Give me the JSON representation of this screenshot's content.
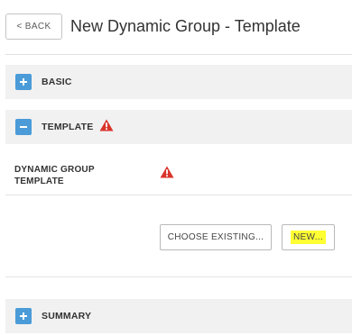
{
  "header": {
    "back_label": "< BACK",
    "title": "New Dynamic Group - Template"
  },
  "sections": {
    "basic": {
      "label": "BASIC",
      "state": "collapsed",
      "icon": "plus-icon"
    },
    "template": {
      "label": "TEMPLATE",
      "state": "expanded",
      "icon": "minus-icon",
      "warning_icon": "warning-icon"
    },
    "summary": {
      "label": "SUMMARY",
      "state": "collapsed",
      "icon": "plus-icon"
    }
  },
  "template_form": {
    "field_label": "DYNAMIC GROUP TEMPLATE",
    "warning_icon": "warning-icon",
    "choose_existing_label": "CHOOSE EXISTING...",
    "new_label": "NEW..."
  },
  "colors": {
    "toggle_blue": "#4a9bd8",
    "warning_red": "#d9342b",
    "highlight_yellow": "#ffff33",
    "section_bg": "#f1f1f1"
  }
}
